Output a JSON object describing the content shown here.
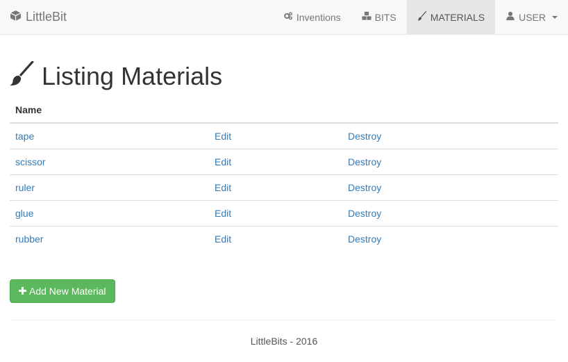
{
  "navbar": {
    "brand": "LittleBit",
    "items": [
      {
        "label": "Inventions",
        "icon": "cogs-icon"
      },
      {
        "label": "BITS",
        "icon": "cubes-icon"
      },
      {
        "label": "MATERIALS",
        "icon": "paint-brush-icon",
        "active": true
      },
      {
        "label": "USER",
        "icon": "user-icon",
        "dropdown": true
      }
    ]
  },
  "page": {
    "title": "Listing Materials",
    "title_icon": "paint-brush-icon"
  },
  "table": {
    "headers": [
      "Name",
      "",
      ""
    ],
    "rows": [
      {
        "name": "tape",
        "edit": "Edit",
        "destroy": "Destroy"
      },
      {
        "name": "scissor",
        "edit": "Edit",
        "destroy": "Destroy"
      },
      {
        "name": "ruler",
        "edit": "Edit",
        "destroy": "Destroy"
      },
      {
        "name": "glue",
        "edit": "Edit",
        "destroy": "Destroy"
      },
      {
        "name": "rubber",
        "edit": "Edit",
        "destroy": "Destroy"
      }
    ]
  },
  "actions": {
    "add_label": "Add New Material",
    "add_icon": "plus-icon"
  },
  "footer": {
    "text": "LittleBits - 2016"
  },
  "colors": {
    "link": "#337ab7",
    "success": "#5cb85c",
    "navbar_bg": "#f8f8f8",
    "active_nav_bg": "#e7e7e7"
  }
}
